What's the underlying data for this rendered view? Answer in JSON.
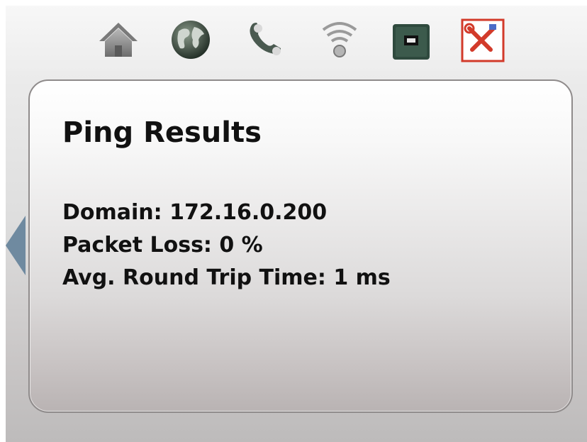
{
  "nav": {
    "icons": [
      {
        "name": "home-icon"
      },
      {
        "name": "globe-icon"
      },
      {
        "name": "phone-icon"
      },
      {
        "name": "wifi-icon"
      },
      {
        "name": "ethernet-port-icon"
      },
      {
        "name": "tools-icon",
        "selected": true
      }
    ],
    "colors": {
      "selected_border": "#d23a2a",
      "arrow": "#6f8aa0"
    }
  },
  "results": {
    "title": "Ping Results",
    "domain": "Domain: 172.16.0.200",
    "packet_loss": "Packet Loss: 0 %",
    "avg_rtt": "Avg. Round Trip Time: 1 ms"
  }
}
